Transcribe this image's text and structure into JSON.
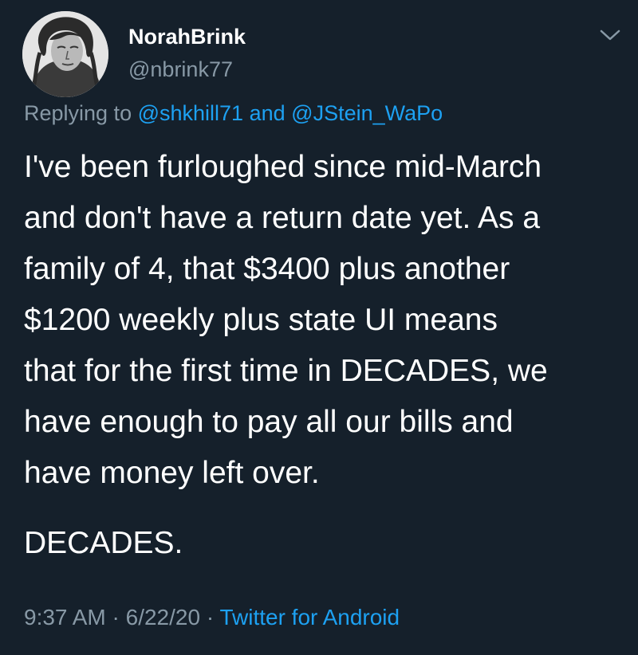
{
  "author": {
    "display_name": "NorahBrink",
    "handle": "@nbrink77"
  },
  "reply": {
    "prefix": "Replying to",
    "mention_1": "@shkhill71",
    "conjunction": "and",
    "mention_2": "@JStein_WaPo"
  },
  "tweet": {
    "lines": [
      "I've been furloughed since mid-March",
      "and don't have a return date yet. As a",
      "family of 4, that $3400 plus another",
      "$1200 weekly plus state UI means",
      "that for the first time in DECADES, we",
      "have enough to pay all our bills and",
      "have money left over."
    ],
    "closing": "DECADES."
  },
  "meta": {
    "time": "9:37 AM",
    "separator": "·",
    "date": "6/22/20",
    "source": "Twitter for Android"
  },
  "colors": {
    "background": "#15202b",
    "text": "#ffffff",
    "secondary": "#8899a6",
    "link": "#1da1f2"
  },
  "icons": {
    "caret": "chevron-down-icon"
  }
}
